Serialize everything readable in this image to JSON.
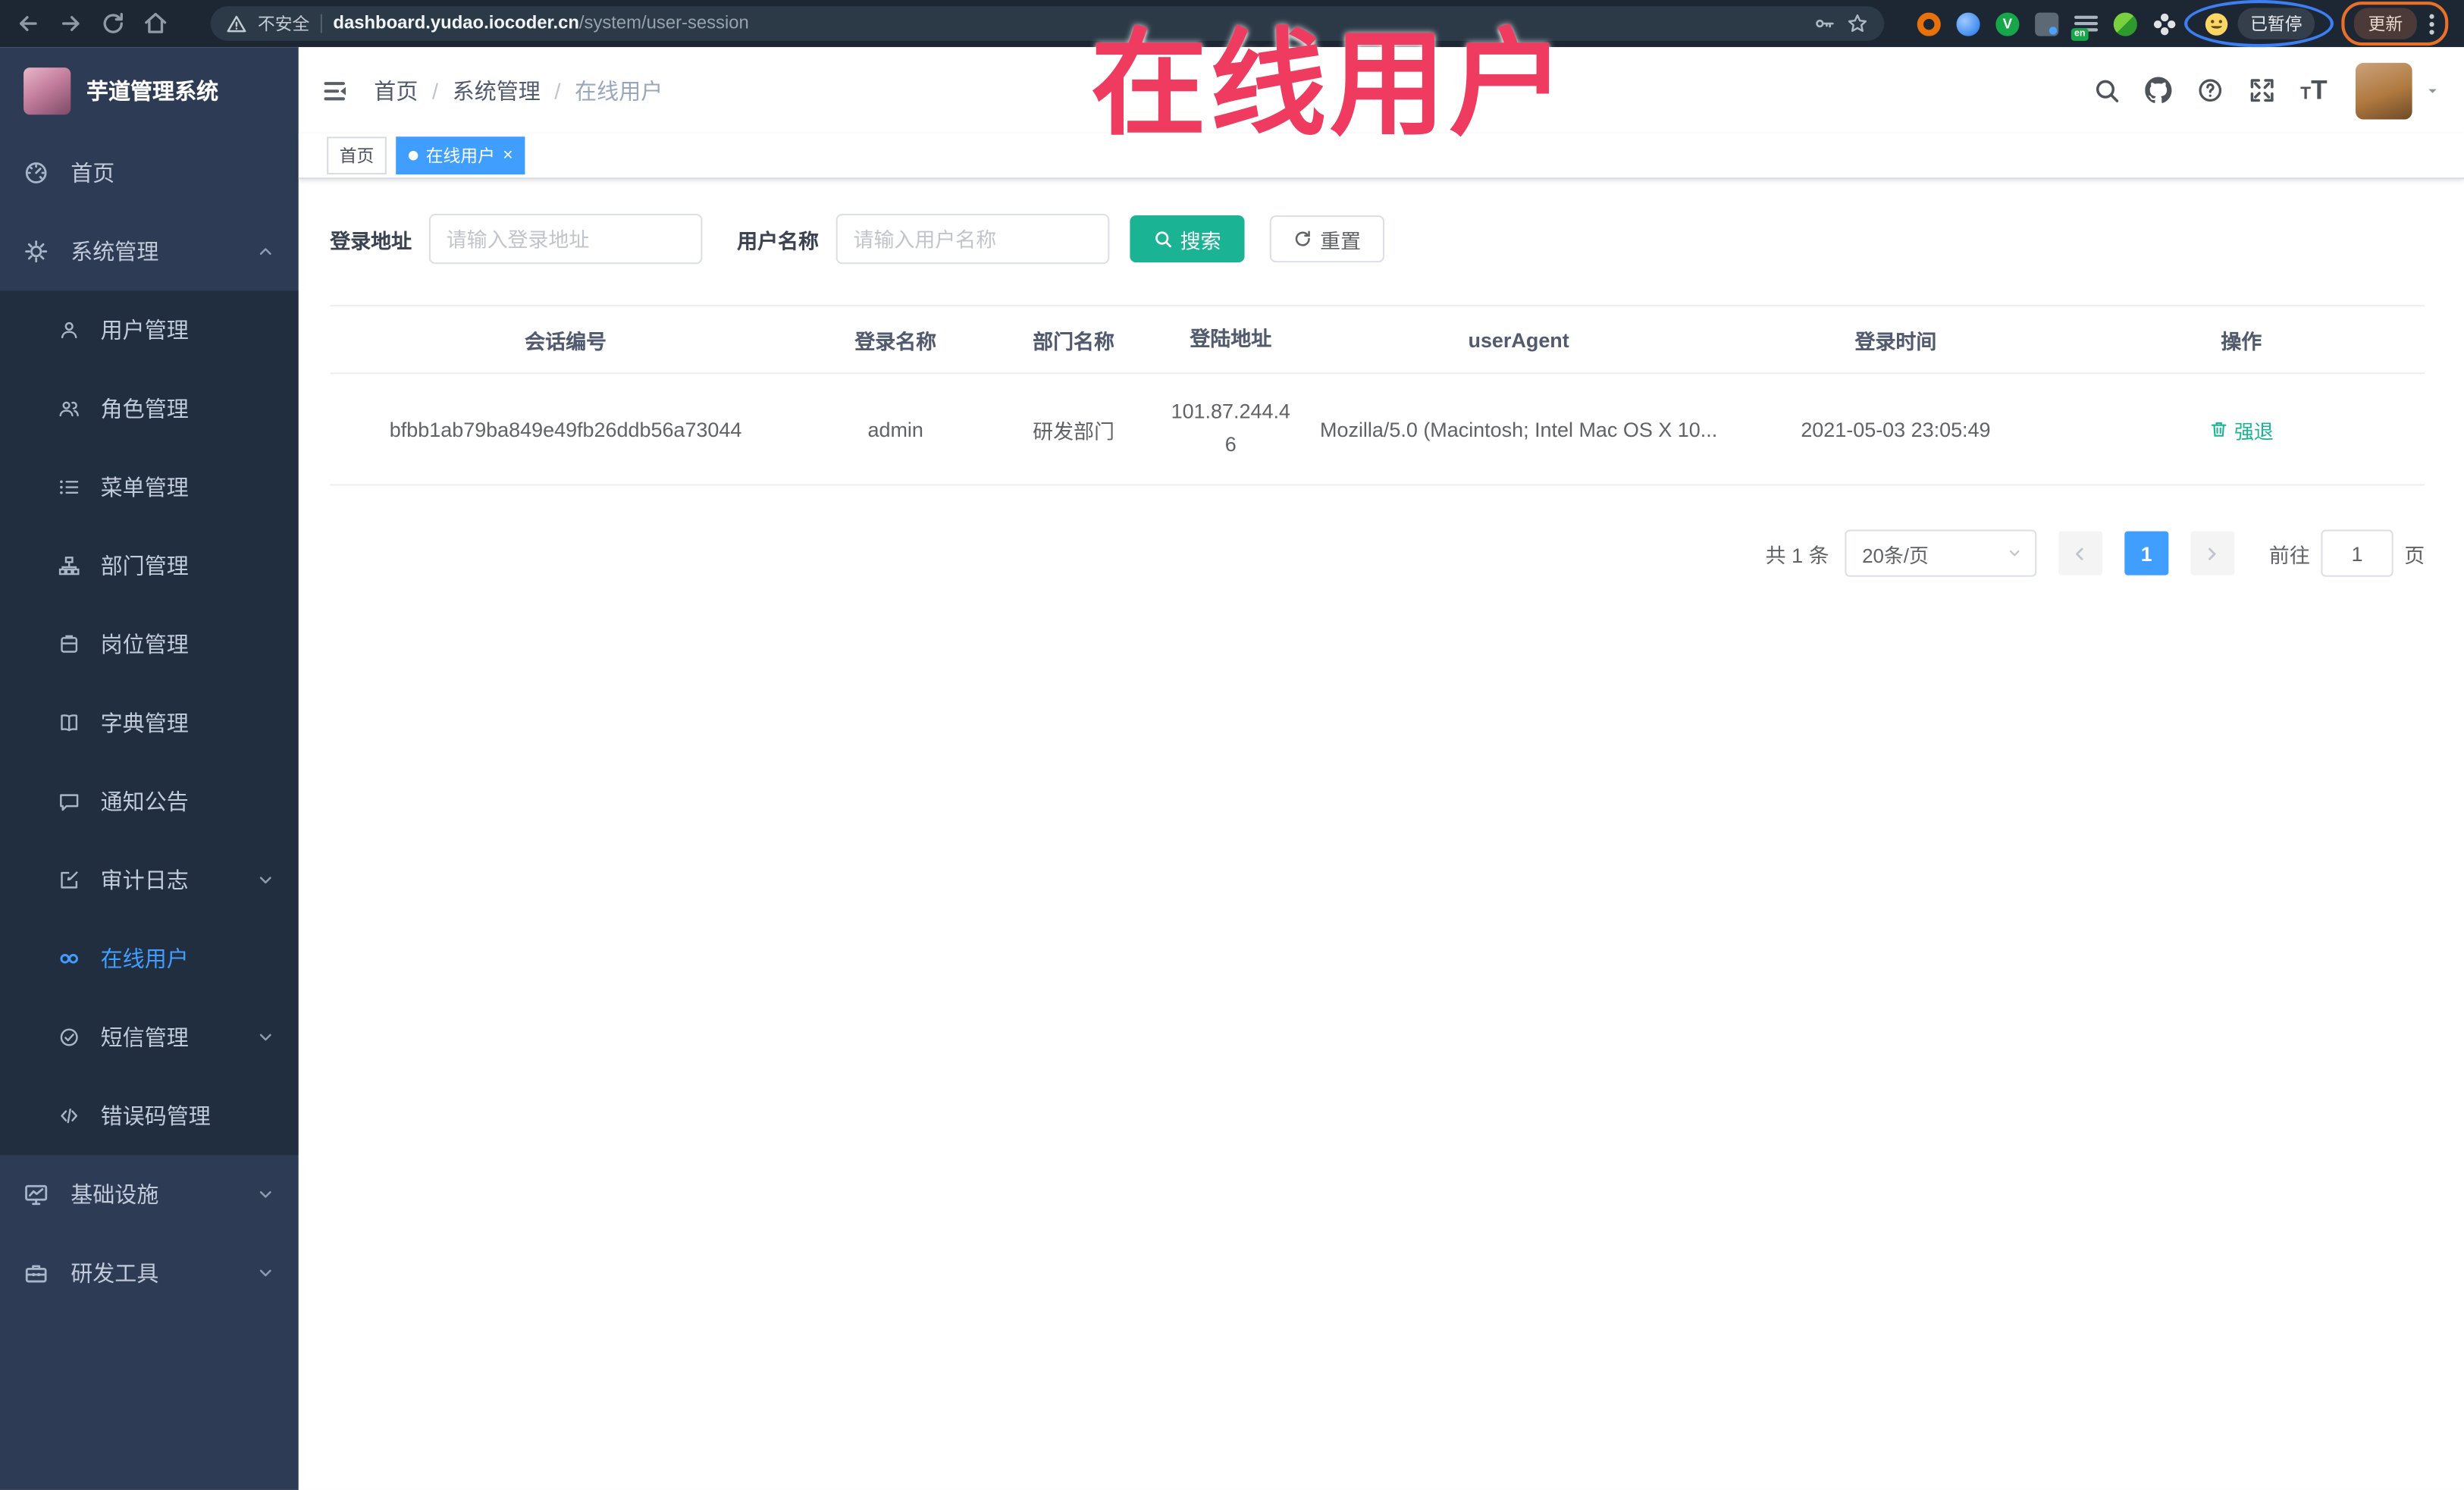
{
  "browser": {
    "security_label": "不安全",
    "url_host": "dashboard.yudao.iocoder.cn",
    "url_path": "/system/user-session",
    "profile_status": "已暂停",
    "update_label": "更新"
  },
  "annotation": {
    "text": "在线用户",
    "color": "#ee3b5f"
  },
  "sidebar": {
    "title": "芋道管理系统",
    "home": {
      "label": "首页"
    },
    "system": {
      "label": "系统管理"
    },
    "system_children": [
      {
        "label": "用户管理"
      },
      {
        "label": "角色管理"
      },
      {
        "label": "菜单管理"
      },
      {
        "label": "部门管理"
      },
      {
        "label": "岗位管理"
      },
      {
        "label": "字典管理"
      },
      {
        "label": "通知公告"
      },
      {
        "label": "审计日志"
      },
      {
        "label": "在线用户",
        "active": true
      },
      {
        "label": "短信管理"
      },
      {
        "label": "错误码管理"
      }
    ],
    "infra": {
      "label": "基础设施"
    },
    "devtools": {
      "label": "研发工具"
    }
  },
  "header": {
    "breadcrumb": [
      "首页",
      "系统管理",
      "在线用户"
    ]
  },
  "tags": {
    "home": "首页",
    "active": "在线用户",
    "close": "×"
  },
  "filters": {
    "addr_label": "登录地址",
    "addr_placeholder": "请输入登录地址",
    "name_label": "用户名称",
    "name_placeholder": "请输入用户名称",
    "search_label": "搜索",
    "reset_label": "重置"
  },
  "table": {
    "columns": [
      "会话编号",
      "登录名称",
      "部门名称",
      "登陆地址",
      "userAgent",
      "登录时间",
      "操作"
    ],
    "rows": [
      {
        "session_id": "bfbb1ab79ba849e49fb26ddb56a73044",
        "login_name": "admin",
        "dept_name": "研发部门",
        "login_ip": "101.87.244.46",
        "user_agent": "Mozilla/5.0 (Macintosh; Intel Mac OS X 10...",
        "login_time": "2021-05-03 23:05:49",
        "action_label": "强退"
      }
    ]
  },
  "pagination": {
    "total": "共 1 条",
    "page_size": "20条/页",
    "current_page": "1",
    "goto_label": "前往",
    "goto_value": "1",
    "page_unit": "页"
  },
  "colors": {
    "accent": "#409eff",
    "button_teal": "#1ab394",
    "annotation_red": "#ee3b5f",
    "sidebar_bg": "#2e3b55",
    "submenu_bg": "#212e3f"
  }
}
